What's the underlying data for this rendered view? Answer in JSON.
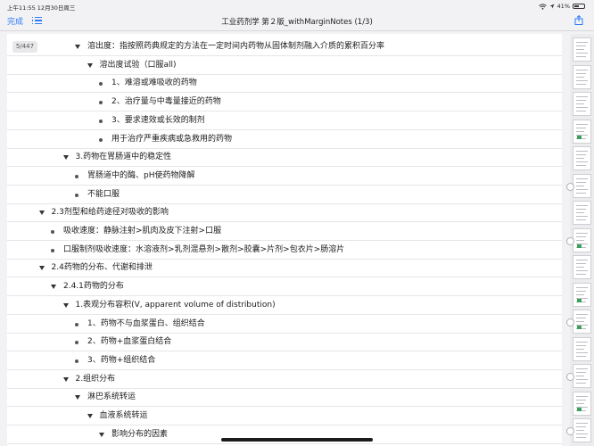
{
  "status_bar": {
    "time_date": "上午11:55 12月30日周三",
    "battery_text": "41%",
    "battery_level": 0.41
  },
  "nav": {
    "done_label": "完成",
    "title": "工业药剂学 第２版_withMarginNotes (1/3)",
    "list_icon": "list-icon",
    "share_icon": "share-icon"
  },
  "page_indicator": "5/447",
  "outline": [
    {
      "text": "溶出度：指按照药典规定的方法在一定时间内药物从固体制剂融入介质的累积百分率",
      "kind": "triangle",
      "level": 4
    },
    {
      "text": "溶出度试验（口服all)",
      "kind": "triangle",
      "level": 5
    },
    {
      "text": "1、难溶或难吸收的药物",
      "kind": "dot",
      "level": 6
    },
    {
      "text": "2、治疗量与中毒量接近的药物",
      "kind": "dot",
      "level": 6
    },
    {
      "text": "3、要求速效或长效的制剂",
      "kind": "dot",
      "level": 6
    },
    {
      "text": "用于治疗严重疾病或急救用的药物",
      "kind": "dot",
      "level": 6
    },
    {
      "text": "3.药物在胃肠道中的稳定性",
      "kind": "triangle",
      "level": 3
    },
    {
      "text": "胃肠道中的酶、pH使药物降解",
      "kind": "dot",
      "level": 4
    },
    {
      "text": "不能口服",
      "kind": "dot",
      "level": 4
    },
    {
      "text": "2.3剂型和给药途径对吸收的影响",
      "kind": "triangle",
      "level": 1
    },
    {
      "text": "吸收速度：静脉注射>肌肉及皮下注射>口服",
      "kind": "dot",
      "level": 2
    },
    {
      "text": "口服制剂吸收速度：水溶液剂>乳剂混悬剂>散剂>胶囊>片剂>包衣片>肠溶片",
      "kind": "dot",
      "level": 2
    },
    {
      "text": "2.4药物的分布、代谢和排泄",
      "kind": "triangle",
      "level": 1
    },
    {
      "text": "2.4.1药物的分布",
      "kind": "triangle",
      "level": 2
    },
    {
      "text": "1.表观分布容积(V, apparent volume of distribution)",
      "kind": "triangle",
      "level": 3
    },
    {
      "text": "1、药物不与血浆蛋白、组织结合",
      "kind": "dot",
      "level": 4
    },
    {
      "text": "2、药物+血浆蛋白结合",
      "kind": "dot",
      "level": 4
    },
    {
      "text": "3、药物+组织结合",
      "kind": "dot",
      "level": 4
    },
    {
      "text": "2.组织分布",
      "kind": "triangle",
      "level": 3
    },
    {
      "text": "淋巴系统转运",
      "kind": "triangle",
      "level": 4
    },
    {
      "text": "血液系统转运",
      "kind": "triangle",
      "level": 5
    },
    {
      "text": "影响分布的因素",
      "kind": "triangle",
      "level": 6
    }
  ]
}
